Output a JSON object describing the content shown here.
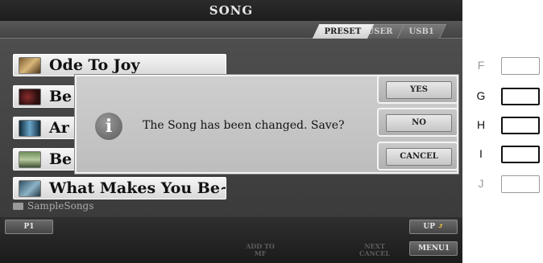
{
  "screen": {
    "title": "SONG",
    "tabs": [
      {
        "label": "PRESET",
        "active": true
      },
      {
        "label": "USER",
        "active": false
      },
      {
        "label": "USB1",
        "active": false
      }
    ]
  },
  "song_list": {
    "items": [
      {
        "label": "Ode To Joy",
        "icon": "statue-thumbnail-icon"
      },
      {
        "label": "Be",
        "icon": "rose-thumbnail-icon"
      },
      {
        "label": "Ar",
        "icon": "stage-thumbnail-icon"
      },
      {
        "label": "Be",
        "icon": "landscape-thumbnail-icon"
      },
      {
        "label": "What Makes You Be~",
        "icon": "portrait-thumbnail-icon"
      }
    ],
    "folder": "SampleSongs"
  },
  "dialog": {
    "message": "The Song has been changed. Save?",
    "icon": "info-icon",
    "icon_glyph": "i",
    "buttons": {
      "yes": "YES",
      "no": "NO",
      "cancel": "CANCEL"
    }
  },
  "bottom_bar": {
    "page": "P1",
    "up": "UP",
    "up_arrow": "⤴",
    "menu": "MENU1",
    "add_to_mf_line1": "ADD TO",
    "add_to_mf_line2": "MF",
    "next_cancel_line1": "NEXT",
    "next_cancel_line2": "CANCEL"
  },
  "panel_buttons": [
    {
      "letter": "F"
    },
    {
      "letter": "G"
    },
    {
      "letter": "H"
    },
    {
      "letter": "I"
    },
    {
      "letter": "J"
    }
  ]
}
